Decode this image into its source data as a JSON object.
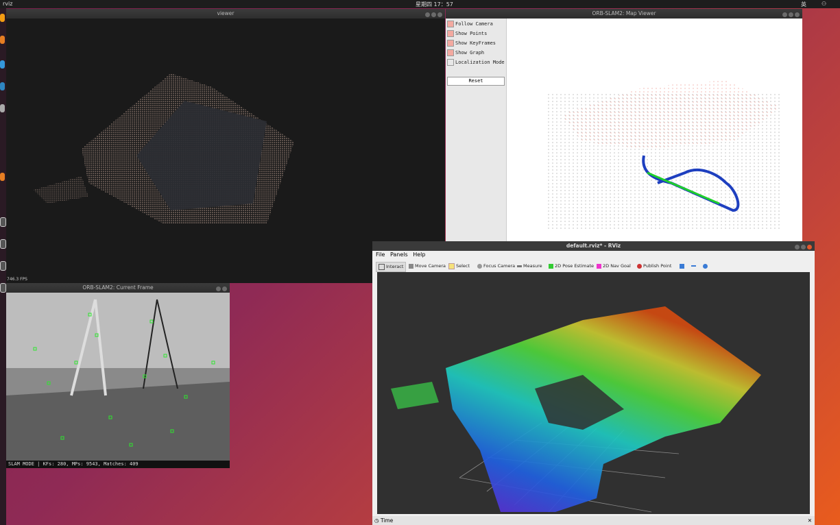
{
  "topbar": {
    "app_label": "rviz",
    "clock": "星期四 17：57",
    "ime": "英"
  },
  "viewer": {
    "title": "viewer",
    "fps": "746.3 FPS"
  },
  "map_viewer": {
    "title": "ORB-SLAM2: Map Viewer",
    "checkboxes": [
      {
        "label": "Follow Camera",
        "checked": true
      },
      {
        "label": "Show Points",
        "checked": true
      },
      {
        "label": "Show KeyFrames",
        "checked": true
      },
      {
        "label": "Show Graph",
        "checked": true
      },
      {
        "label": "Localization Mode",
        "checked": false
      }
    ],
    "reset_label": "Reset"
  },
  "current_frame": {
    "title": "ORB-SLAM2: Current Frame",
    "status": "SLAM MODE |  KFs: 280, MPs: 9543, Matches: 409"
  },
  "rviz": {
    "title": "default.rviz* - RViz",
    "menu": {
      "file": "File",
      "panels": "Panels",
      "help": "Help"
    },
    "tools": {
      "interact": "Interact",
      "move_camera": "Move Camera",
      "select": "Select",
      "focus_camera": "Focus Camera",
      "measure": "Measure",
      "pose_estimate": "2D Pose Estimate",
      "nav_goal": "2D Nav Goal",
      "publish_point": "Publish Point"
    },
    "time_label": "Time"
  }
}
